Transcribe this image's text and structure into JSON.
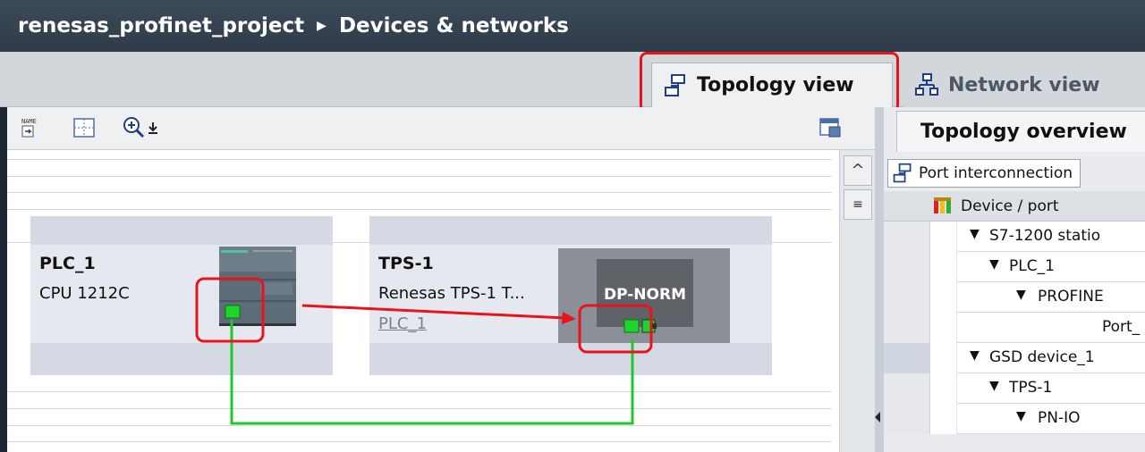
{
  "breadcrumb": {
    "project": "renesas_profinet_project",
    "separator": "▶",
    "section": "Devices & networks"
  },
  "tabs": {
    "topology": "Topology view",
    "network": "Network view"
  },
  "toolbar": {
    "name_label": "NAME"
  },
  "devices": {
    "plc": {
      "name": "PLC_1",
      "type": "CPU 1212C"
    },
    "tps": {
      "name": "TPS-1",
      "type": "Renesas TPS-1 T...",
      "controller": "PLC_1",
      "module_label": "DP-NORM"
    }
  },
  "topology_overview": {
    "title": "Topology overview",
    "port_interconnection": "Port interconnection",
    "column_header": "Device / port",
    "rows": [
      {
        "label": "S7-1200 statio"
      },
      {
        "label": "PLC_1"
      },
      {
        "label": "PROFINE"
      },
      {
        "label": "Port_"
      },
      {
        "label": "GSD device_1"
      },
      {
        "label": "TPS-1"
      },
      {
        "label": "PN-IO"
      }
    ]
  },
  "colors": {
    "title_bg": "#2f3b49",
    "highlight_red": "#e8141b",
    "port_green": "#1fd42a",
    "link_green": "#22c52b"
  }
}
